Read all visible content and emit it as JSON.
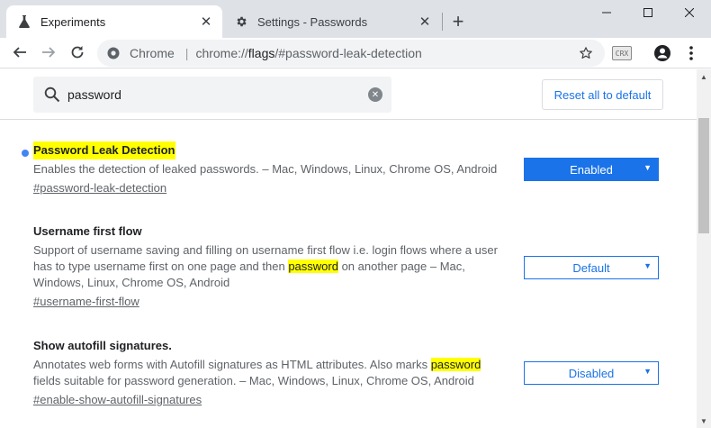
{
  "tabs": [
    {
      "title": "Experiments",
      "icon": "flask-icon",
      "active": true
    },
    {
      "title": "Settings - Passwords",
      "icon": "gear-icon",
      "active": false
    }
  ],
  "toolbar": {
    "omnibox_site": "Chrome",
    "url_prefix": "chrome://",
    "url_highlight": "flags",
    "url_suffix": "/#password-leak-detection",
    "extension_label": "CRX"
  },
  "search": {
    "value": "password",
    "reset_label": "Reset all to default"
  },
  "flags": [
    {
      "name": "Password Leak Detection",
      "description": "Enables the detection of leaked passwords. – Mac, Windows, Linux, Chrome OS, Android",
      "link": "#password-leak-detection",
      "state": "Enabled"
    },
    {
      "name": "Username first flow",
      "description_line1": "Support of username saving and filling on username first flow i.e. login flows where a user",
      "description_line2_pre": "has to type username first on one page and then ",
      "description_line2_mark": "password",
      "description_line2_post": " on another page – Mac,",
      "description_line3": "Windows, Linux, Chrome OS, Android",
      "link": "#username-first-flow",
      "state": "Default"
    },
    {
      "name": "Show autofill signatures.",
      "description_line1_pre": "Annotates web forms with Autofill signatures as HTML attributes. Also marks ",
      "description_line1_mark": "password",
      "description_line2": "fields suitable for password generation. – Mac, Windows, Linux, Chrome OS, Android",
      "link": "#enable-show-autofill-signatures",
      "state": "Disabled"
    }
  ],
  "colors": {
    "accent": "#1a73e8",
    "highlight": "#ffff00",
    "modified_dot": "#4285f4"
  }
}
